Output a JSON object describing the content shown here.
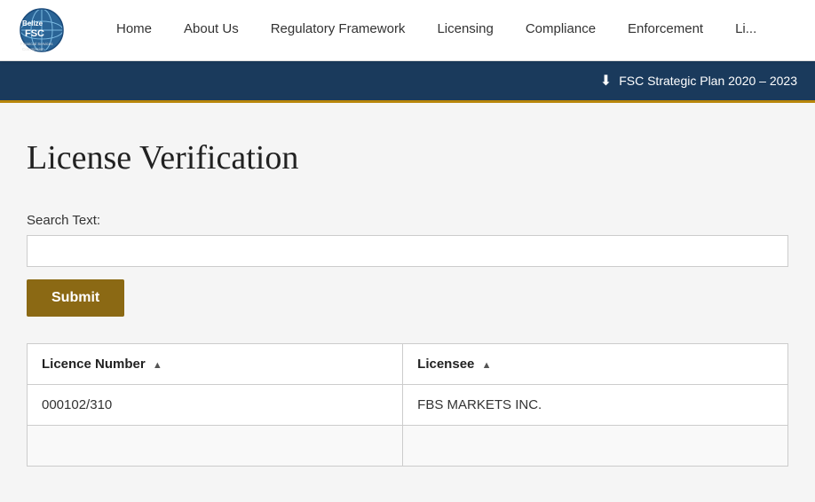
{
  "logo": {
    "alt": "Belize FSC Logo",
    "title_line1": "Belize",
    "title_line2": "FSC",
    "subtitle": "Financial Services Commission"
  },
  "nav": {
    "items": [
      {
        "label": "Home",
        "id": "home"
      },
      {
        "label": "About Us",
        "id": "about"
      },
      {
        "label": "Regulatory Framework",
        "id": "regulatory"
      },
      {
        "label": "Licensing",
        "id": "licensing"
      },
      {
        "label": "Compliance",
        "id": "compliance"
      },
      {
        "label": "Enforcement",
        "id": "enforcement"
      },
      {
        "label": "Li...",
        "id": "li"
      }
    ]
  },
  "banner": {
    "icon": "⬇",
    "text": "FSC Strategic Plan 2020 – 2023"
  },
  "page": {
    "title": "License Verification",
    "form": {
      "label": "Search Text:",
      "input_value": "",
      "input_placeholder": "",
      "submit_label": "Submit"
    },
    "table": {
      "columns": [
        {
          "label": "Licence Number",
          "sort": "▲"
        },
        {
          "label": "Licensee",
          "sort": "▲"
        }
      ],
      "rows": [
        {
          "licence_number": "000102/310",
          "licensee": "FBS MARKETS INC."
        }
      ]
    }
  }
}
